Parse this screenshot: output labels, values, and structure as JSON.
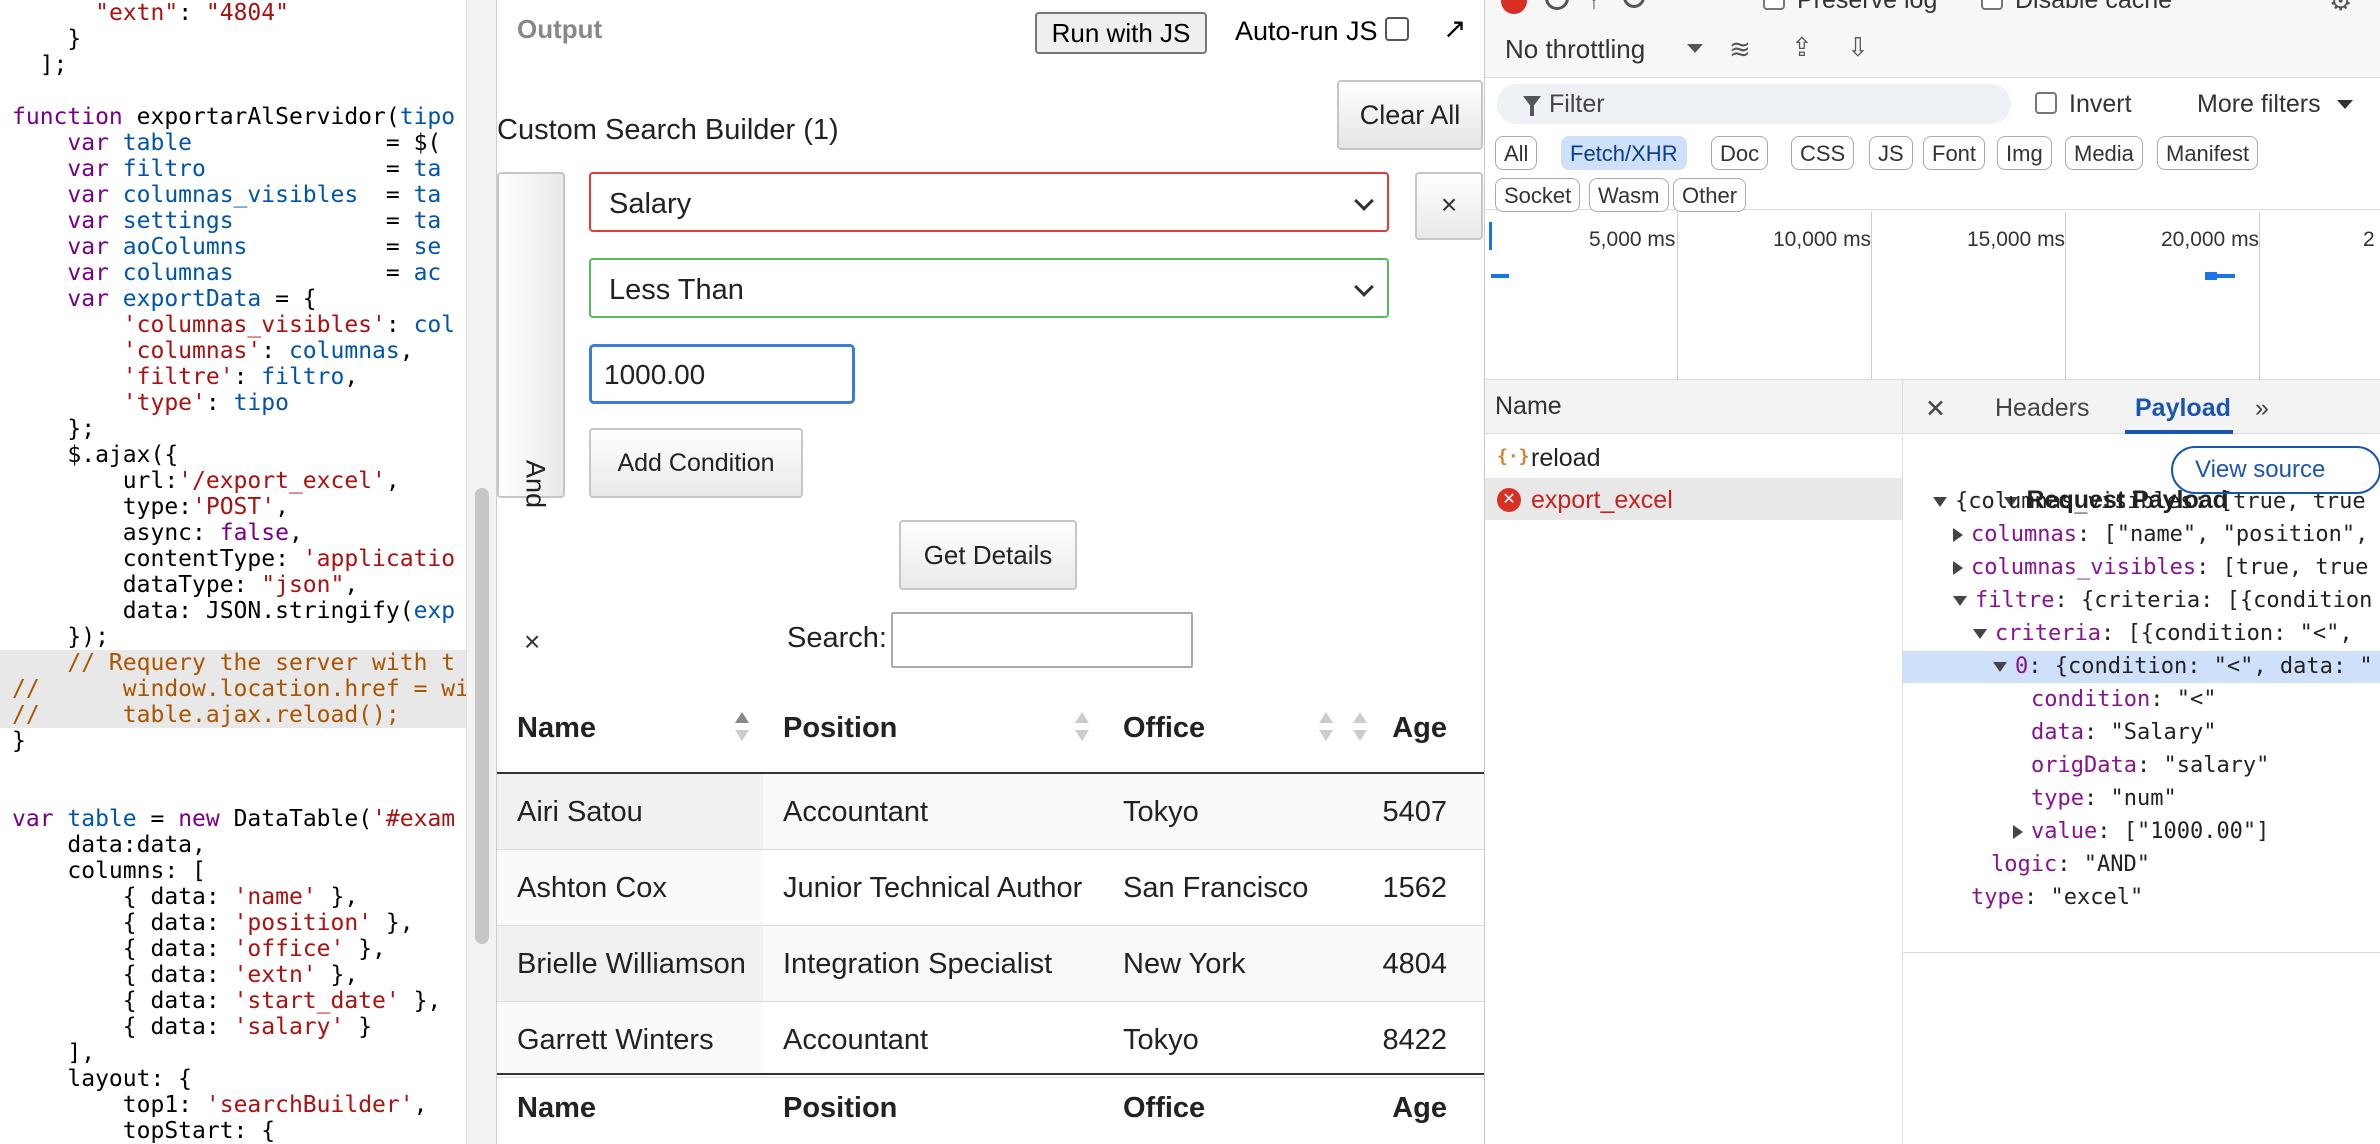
{
  "code": {
    "lines": [
      [
        {
          "t": "      ",
          "c": "pr"
        },
        {
          "t": "\"extn\"",
          "c": "st"
        },
        {
          "t": ": ",
          "c": "pr"
        },
        {
          "t": "\"4804\"",
          "c": "st"
        }
      ],
      [
        {
          "t": "    }",
          "c": "pr"
        }
      ],
      [
        {
          "t": "  ];",
          "c": "pr"
        }
      ],
      [
        {
          "t": "",
          "c": "pr"
        }
      ],
      [
        {
          "t": "function ",
          "c": "kw"
        },
        {
          "t": "exportarAlServidor(",
          "c": "pr"
        },
        {
          "t": "tipo",
          "c": "vr"
        }
      ],
      [
        {
          "t": "    var ",
          "c": "kw"
        },
        {
          "t": "table",
          "c": "vr"
        },
        {
          "t": "              = $(",
          "c": "pr"
        }
      ],
      [
        {
          "t": "    var ",
          "c": "kw"
        },
        {
          "t": "filtro",
          "c": "vr"
        },
        {
          "t": "             = ",
          "c": "pr"
        },
        {
          "t": "ta",
          "c": "vr"
        }
      ],
      [
        {
          "t": "    var ",
          "c": "kw"
        },
        {
          "t": "columnas_visibles",
          "c": "vr"
        },
        {
          "t": "  = ",
          "c": "pr"
        },
        {
          "t": "ta",
          "c": "vr"
        }
      ],
      [
        {
          "t": "    var ",
          "c": "kw"
        },
        {
          "t": "settings",
          "c": "vr"
        },
        {
          "t": "           = ",
          "c": "pr"
        },
        {
          "t": "ta",
          "c": "vr"
        }
      ],
      [
        {
          "t": "    var ",
          "c": "kw"
        },
        {
          "t": "aoColumns",
          "c": "vr"
        },
        {
          "t": "          = ",
          "c": "pr"
        },
        {
          "t": "se",
          "c": "vr"
        }
      ],
      [
        {
          "t": "    var ",
          "c": "kw"
        },
        {
          "t": "columnas",
          "c": "vr"
        },
        {
          "t": "           = ",
          "c": "pr"
        },
        {
          "t": "ac",
          "c": "vr"
        }
      ],
      [
        {
          "t": "    var ",
          "c": "kw"
        },
        {
          "t": "exportData",
          "c": "vr"
        },
        {
          "t": " = {",
          "c": "pr"
        }
      ],
      [
        {
          "t": "        'columnas_visibles'",
          "c": "st"
        },
        {
          "t": ": ",
          "c": "pr"
        },
        {
          "t": "col",
          "c": "vr"
        }
      ],
      [
        {
          "t": "        'columnas'",
          "c": "st"
        },
        {
          "t": ": ",
          "c": "pr"
        },
        {
          "t": "columnas",
          "c": "vr"
        },
        {
          "t": ",",
          "c": "pr"
        }
      ],
      [
        {
          "t": "        'filtre'",
          "c": "st"
        },
        {
          "t": ": ",
          "c": "pr"
        },
        {
          "t": "filtro",
          "c": "vr"
        },
        {
          "t": ",",
          "c": "pr"
        }
      ],
      [
        {
          "t": "        'type'",
          "c": "st"
        },
        {
          "t": ": ",
          "c": "pr"
        },
        {
          "t": "tipo",
          "c": "vr"
        }
      ],
      [
        {
          "t": "    };",
          "c": "pr"
        }
      ],
      [
        {
          "t": "    $.ajax({",
          "c": "pr"
        }
      ],
      [
        {
          "t": "        url:",
          "c": "pr"
        },
        {
          "t": "'/export_excel'",
          "c": "st"
        },
        {
          "t": ",",
          "c": "pr"
        }
      ],
      [
        {
          "t": "        type:",
          "c": "pr"
        },
        {
          "t": "'POST'",
          "c": "st"
        },
        {
          "t": ",",
          "c": "pr"
        }
      ],
      [
        {
          "t": "        async: ",
          "c": "pr"
        },
        {
          "t": "false",
          "c": "kw"
        },
        {
          "t": ",",
          "c": "pr"
        }
      ],
      [
        {
          "t": "        contentType: ",
          "c": "pr"
        },
        {
          "t": "'applicatio",
          "c": "st"
        }
      ],
      [
        {
          "t": "        dataType: ",
          "c": "pr"
        },
        {
          "t": "\"json\"",
          "c": "st"
        },
        {
          "t": ",",
          "c": "pr"
        }
      ],
      [
        {
          "t": "        data: JSON.stringify(",
          "c": "pr"
        },
        {
          "t": "exp",
          "c": "vr"
        }
      ],
      [
        {
          "t": "    });",
          "c": "pr"
        }
      ],
      [
        {
          "t": "    // Requery the server with t",
          "c": "cm"
        }
      ],
      [
        {
          "t": "//      window.location.href = wi",
          "c": "cm"
        }
      ],
      [
        {
          "t": "//      table.ajax.reload();",
          "c": "cm"
        }
      ],
      [
        {
          "t": "}",
          "c": "pr"
        }
      ],
      [
        {
          "t": "",
          "c": "pr"
        }
      ],
      [
        {
          "t": "",
          "c": "pr"
        }
      ],
      [
        {
          "t": "var ",
          "c": "kw"
        },
        {
          "t": "table",
          "c": "vr"
        },
        {
          "t": " = ",
          "c": "pr"
        },
        {
          "t": "new ",
          "c": "kw"
        },
        {
          "t": "DataTable(",
          "c": "pr"
        },
        {
          "t": "'#exam",
          "c": "st"
        }
      ],
      [
        {
          "t": "    data:data,",
          "c": "pr"
        }
      ],
      [
        {
          "t": "    columns: [",
          "c": "pr"
        }
      ],
      [
        {
          "t": "        { data: ",
          "c": "pr"
        },
        {
          "t": "'name'",
          "c": "st"
        },
        {
          "t": " },",
          "c": "pr"
        }
      ],
      [
        {
          "t": "        { data: ",
          "c": "pr"
        },
        {
          "t": "'position'",
          "c": "st"
        },
        {
          "t": " },",
          "c": "pr"
        }
      ],
      [
        {
          "t": "        { data: ",
          "c": "pr"
        },
        {
          "t": "'office'",
          "c": "st"
        },
        {
          "t": " },",
          "c": "pr"
        }
      ],
      [
        {
          "t": "        { data: ",
          "c": "pr"
        },
        {
          "t": "'extn'",
          "c": "st"
        },
        {
          "t": " },",
          "c": "pr"
        }
      ],
      [
        {
          "t": "        { data: ",
          "c": "pr"
        },
        {
          "t": "'start_date'",
          "c": "st"
        },
        {
          "t": " },",
          "c": "pr"
        }
      ],
      [
        {
          "t": "        { data: ",
          "c": "pr"
        },
        {
          "t": "'salary'",
          "c": "st"
        },
        {
          "t": " }",
          "c": "pr"
        }
      ],
      [
        {
          "t": "    ],",
          "c": "pr"
        }
      ],
      [
        {
          "t": "    layout: {",
          "c": "pr"
        }
      ],
      [
        {
          "t": "        top1: ",
          "c": "pr"
        },
        {
          "t": "'searchBuilder'",
          "c": "st"
        },
        {
          "t": ",",
          "c": "pr"
        }
      ],
      [
        {
          "t": "        topStart: {",
          "c": "pr"
        }
      ]
    ],
    "highlighted": [
      25,
      26,
      27
    ]
  },
  "output": {
    "title": "Output",
    "run_label": "Run with JS",
    "autorun_label": "Auto-run JS",
    "popout_glyph": "↗",
    "sb_title": "Custom Search Builder (1)",
    "clear_all": "Clear All",
    "logic_label": "And",
    "logic_close": "×",
    "column_value": "Salary",
    "condition_value": "Less Than",
    "delete_glyph": "×",
    "value_input": "1000.00",
    "add_condition": "Add Condition",
    "get_details": "Get Details",
    "search_label": "Search:",
    "headers": [
      "Name",
      "Position",
      "Office",
      "Age"
    ],
    "rows": [
      [
        "Airi Satou",
        "Accountant",
        "Tokyo",
        "5407"
      ],
      [
        "Ashton Cox",
        "Junior Technical Author",
        "San Francisco",
        "1562"
      ],
      [
        "Brielle Williamson",
        "Integration Specialist",
        "New York",
        "4804"
      ],
      [
        "Garrett Winters",
        "Accountant",
        "Tokyo",
        "8422"
      ]
    ]
  },
  "devtools": {
    "preserve_log": "Preserve log",
    "disable_cache": "Disable cache",
    "throttling": "No throttling",
    "filter_placeholder": "Filter",
    "invert": "Invert",
    "more_filters": "More filters",
    "chips": [
      "All",
      "Fetch/XHR",
      "Doc",
      "CSS",
      "JS",
      "Font",
      "Img",
      "Media",
      "Manifest",
      "Socket",
      "Wasm",
      "Other"
    ],
    "active_chip": "Fetch/XHR",
    "timeline_labels": [
      "5,000 ms",
      "10,000 ms",
      "15,000 ms",
      "20,000 ms",
      "2"
    ],
    "name_header": "Name",
    "requests": [
      {
        "name": "reload",
        "status": "xhr",
        "icon": "{·}"
      },
      {
        "name": "export_excel",
        "status": "error",
        "icon": "✕"
      }
    ],
    "tabs": {
      "close": "✕",
      "headers": "Headers",
      "payload": "Payload",
      "more": "»"
    },
    "payload_title": "Request Payload",
    "view_source": "View source",
    "tree": [
      {
        "indent": 0,
        "arrow": "down",
        "key": "",
        "val": "{columnas_visibles: [true, true",
        "hl": false
      },
      {
        "indent": 1,
        "arrow": "right",
        "key": "columnas",
        "val": ": [\"name\", \"position\",",
        "hl": false
      },
      {
        "indent": 1,
        "arrow": "right",
        "key": "columnas_visibles",
        "val": ": [true, true",
        "hl": false
      },
      {
        "indent": 1,
        "arrow": "down",
        "key": "filtre",
        "val": ": {criteria: [{condition",
        "hl": false
      },
      {
        "indent": 2,
        "arrow": "down",
        "key": "criteria",
        "val": ": [{condition: \"<\",",
        "hl": false
      },
      {
        "indent": 3,
        "arrow": "down",
        "key": "0",
        "val": ": {condition: \"<\", data: \"",
        "hl": true
      },
      {
        "indent": 4,
        "arrow": "",
        "key": "condition",
        "val": ": \"<\"",
        "hl": false
      },
      {
        "indent": 4,
        "arrow": "",
        "key": "data",
        "val": ": \"Salary\"",
        "hl": false
      },
      {
        "indent": 4,
        "arrow": "",
        "key": "origData",
        "val": ": \"salary\"",
        "hl": false
      },
      {
        "indent": 4,
        "arrow": "",
        "key": "type",
        "val": ": \"num\"",
        "hl": false
      },
      {
        "indent": 4,
        "arrow": "right",
        "key": "value",
        "val": ": [\"1000.00\"]",
        "hl": false
      },
      {
        "indent": 2,
        "arrow": "",
        "key": "logic",
        "val": ": \"AND\"",
        "hl": false
      },
      {
        "indent": 1,
        "arrow": "",
        "key": "type",
        "val": ": \"excel\"",
        "hl": false
      }
    ]
  }
}
